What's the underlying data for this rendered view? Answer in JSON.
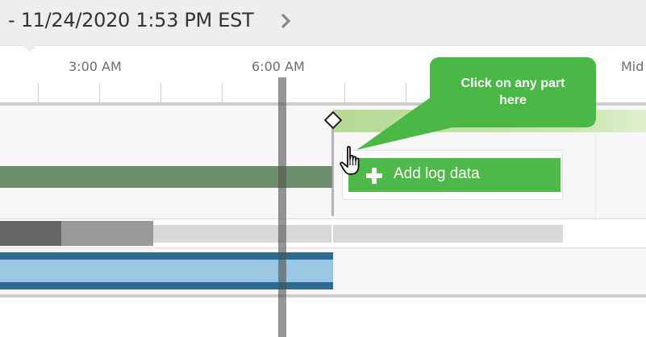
{
  "header": {
    "datetime": "-  11/24/2020 1:53 PM EST",
    "next_icon": "chevron-right-icon"
  },
  "ruler": {
    "labels": [
      "3:00 AM",
      "6:00 AM",
      "Mid"
    ]
  },
  "log": {
    "add_label": "Add log data",
    "plus_icon": "plus-icon"
  },
  "callout": {
    "line1": "Click on any part",
    "line2": "here"
  },
  "cursor": {
    "icon": "hand-pointer-icon"
  },
  "colors": {
    "accent_green": "#4fb84a",
    "callout_green": "#4bb846",
    "light_green_bar": "#b6da95",
    "dark_green_bar": "#6e8f6e",
    "blue_bar": "#2d6c92",
    "light_blue_bar": "#9ac6e2"
  }
}
